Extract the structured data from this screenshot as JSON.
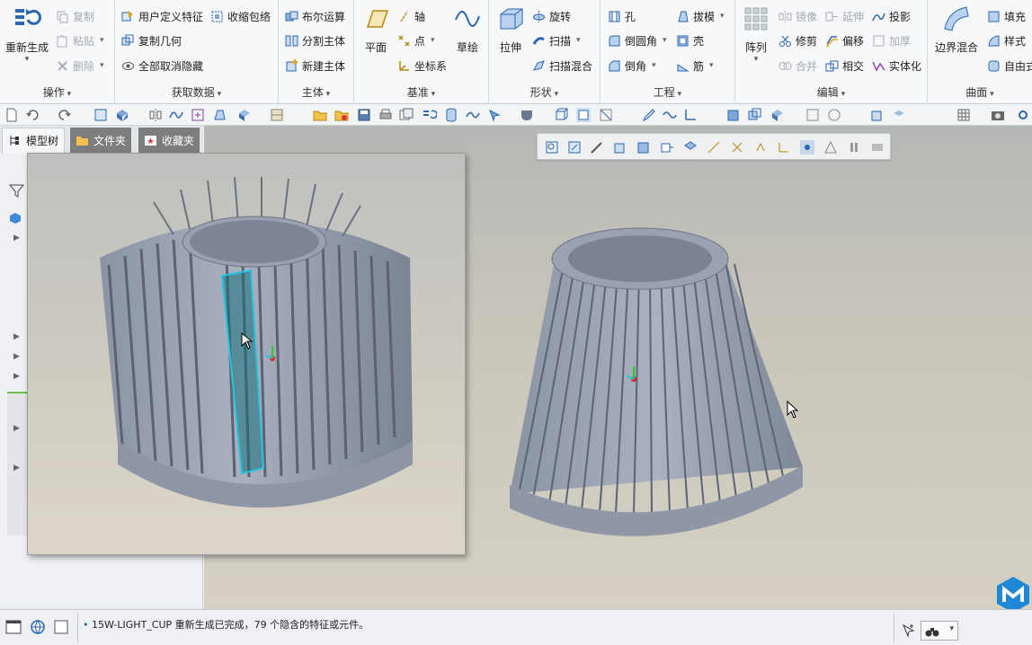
{
  "ribbon": {
    "groups": {
      "operations": {
        "label": "操作",
        "regenerate": "重新生成",
        "copy": "复制",
        "paste": "粘贴",
        "delete": "删除"
      },
      "get_data": {
        "label": "获取数据",
        "udf": "用户定义特征",
        "shrinkwrap": "收缩包络",
        "copy_geometry": "复制几何",
        "unhide_all": "全部取消隐藏"
      },
      "body": {
        "label": "主体",
        "boolean": "布尔运算",
        "split": "分割主体",
        "new_body": "新建主体"
      },
      "datum": {
        "label": "基准",
        "plane": "平面",
        "axis": "轴",
        "point": "点",
        "csys": "坐标系",
        "sketch": "草绘"
      },
      "shapes": {
        "label": "形状",
        "extrude": "拉伸",
        "revolve": "旋转",
        "sweep": "扫描",
        "swept_blend": "扫描混合"
      },
      "engineering": {
        "label": "工程",
        "hole": "孔",
        "round": "倒圆角",
        "chamfer": "倒角",
        "draft": "拔模",
        "shell": "壳",
        "rib": "筋"
      },
      "editing": {
        "label": "编辑",
        "pattern": "阵列",
        "mirror": "镜像",
        "trim": "修剪",
        "merge": "合并",
        "extend": "延伸",
        "offset": "偏移",
        "intersect": "相交",
        "project": "投影",
        "thicken": "加厚",
        "solidify": "实体化"
      },
      "surfaces": {
        "label": "曲面",
        "boundary_blend": "边界混合",
        "fill": "填充",
        "style": "样式",
        "freestyle": "自由式"
      }
    }
  },
  "left_panel": {
    "tabs": [
      {
        "label": "模型树",
        "active": true
      },
      {
        "label": "文件夹",
        "active": false
      },
      {
        "label": "收藏夹",
        "active": false
      }
    ]
  },
  "status_bar": {
    "message": "15W-LIGHT_CUP 重新生成已完成，79 个隐含的特征或元件。"
  },
  "colors": {
    "accent_blue": "#1e5fa8",
    "model_gray": "#9aa3b2",
    "highlight_cyan": "#27c4e0",
    "brand_logo": "#1e88d6"
  }
}
